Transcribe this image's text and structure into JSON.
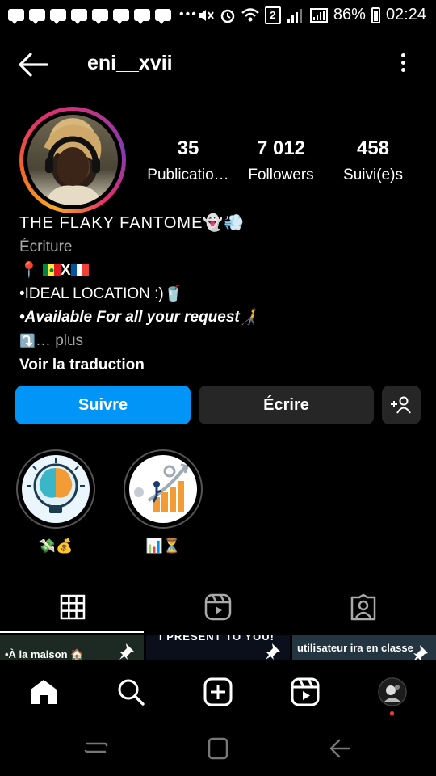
{
  "status_bar": {
    "sim_slot": "2",
    "battery": "86%",
    "time": "02:24"
  },
  "header": {
    "username": "eni__xvii"
  },
  "profile": {
    "stats": [
      {
        "value": "35",
        "label": "Publicatio…"
      },
      {
        "value": "7 012",
        "label": "Followers"
      },
      {
        "value": "458",
        "label": "Suivi(e)s"
      }
    ],
    "bio": {
      "name": "THE FLAKY FANTOME👻💨",
      "category": "Écriture",
      "location_pin": "📍",
      "flag_separator": "X",
      "line_ideal": "•IDEAL LOCATION :)🥤",
      "line_available": "•Available For all your request🧑‍🦯",
      "more_prefix": "⤵️",
      "more_text": "… plus",
      "translate": "Voir la traduction"
    }
  },
  "actions": {
    "follow": "Suivre",
    "message": "Écrire"
  },
  "highlights": [
    {
      "label": "💸💰"
    },
    {
      "label": "📊⏳"
    }
  ],
  "grid_preview": [
    {
      "text": "•À la maison 🏠"
    },
    {
      "text": "I PRESENT TO YOU!"
    },
    {
      "text": "utilisateur ira en classe"
    }
  ],
  "colors": {
    "follow_button": "#0095f6",
    "secondary_button": "#262626",
    "background": "#000000",
    "notification_dot": "#ff3040"
  }
}
